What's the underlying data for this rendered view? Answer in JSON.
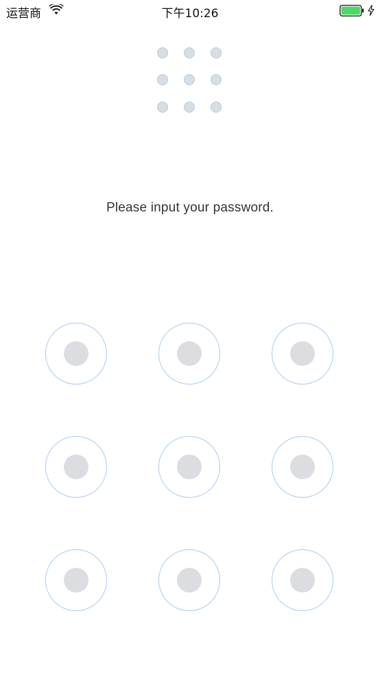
{
  "status_bar": {
    "carrier": "运营商",
    "time": "下午10:26",
    "battery_color": "#4cd964",
    "icons": [
      "wifi-icon",
      "battery-icon",
      "charging-bolt-icon"
    ]
  },
  "pattern_preview": {
    "rows": 3,
    "cols": 3,
    "dot_color": "#dcdde0",
    "ring_color": "#a9ccef"
  },
  "prompt": {
    "text": "Please input your password."
  },
  "pattern_lock": {
    "rows": 3,
    "cols": 3,
    "ring_color": "#a9ccef",
    "center_color": "#dcdde0"
  }
}
